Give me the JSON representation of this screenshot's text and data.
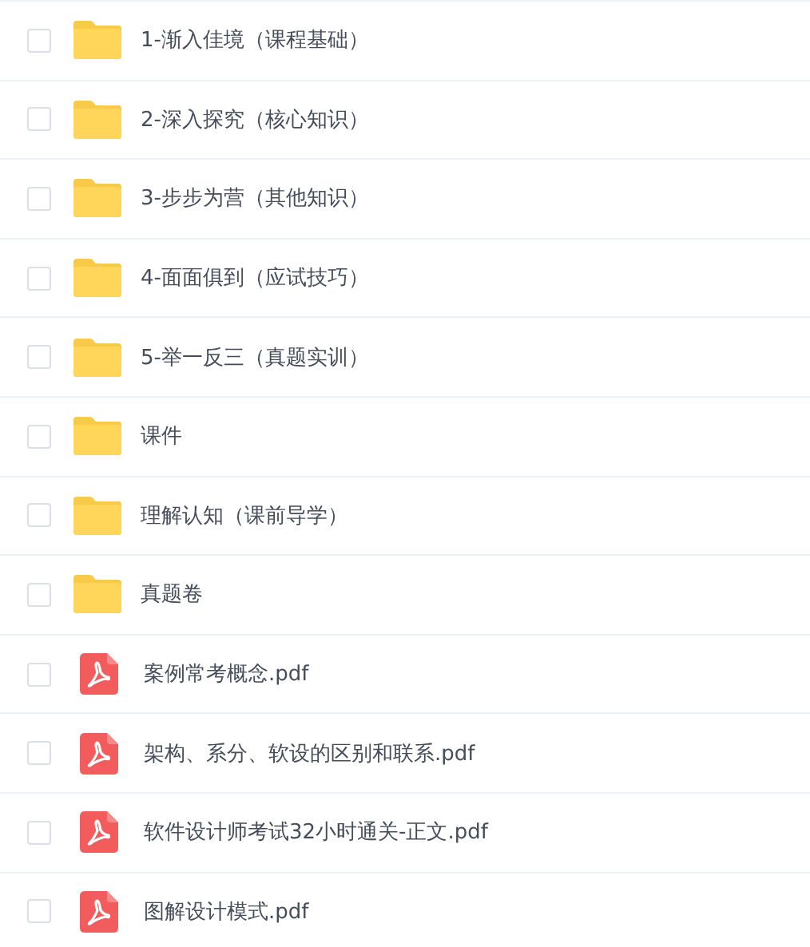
{
  "files": [
    {
      "kind": "folder",
      "name": "1-渐入佳境（课程基础）",
      "checked": false
    },
    {
      "kind": "folder",
      "name": "2-深入探究（核心知识）",
      "checked": false
    },
    {
      "kind": "folder",
      "name": "3-步步为营（其他知识）",
      "checked": false
    },
    {
      "kind": "folder",
      "name": "4-面面俱到（应试技巧）",
      "checked": false
    },
    {
      "kind": "folder",
      "name": "5-举一反三（真题实训）",
      "checked": false
    },
    {
      "kind": "folder",
      "name": "课件",
      "checked": false
    },
    {
      "kind": "folder",
      "name": "理解认知（课前导学）",
      "checked": false
    },
    {
      "kind": "folder",
      "name": "真题卷",
      "checked": false
    },
    {
      "kind": "pdf",
      "name": "案例常考概念.pdf",
      "checked": false
    },
    {
      "kind": "pdf",
      "name": "架构、系分、软设的区别和联系.pdf",
      "checked": false
    },
    {
      "kind": "pdf",
      "name": "软件设计师考试32小时通关-正文.pdf",
      "checked": false
    },
    {
      "kind": "pdf",
      "name": "图解设计模式.pdf",
      "checked": false
    }
  ]
}
